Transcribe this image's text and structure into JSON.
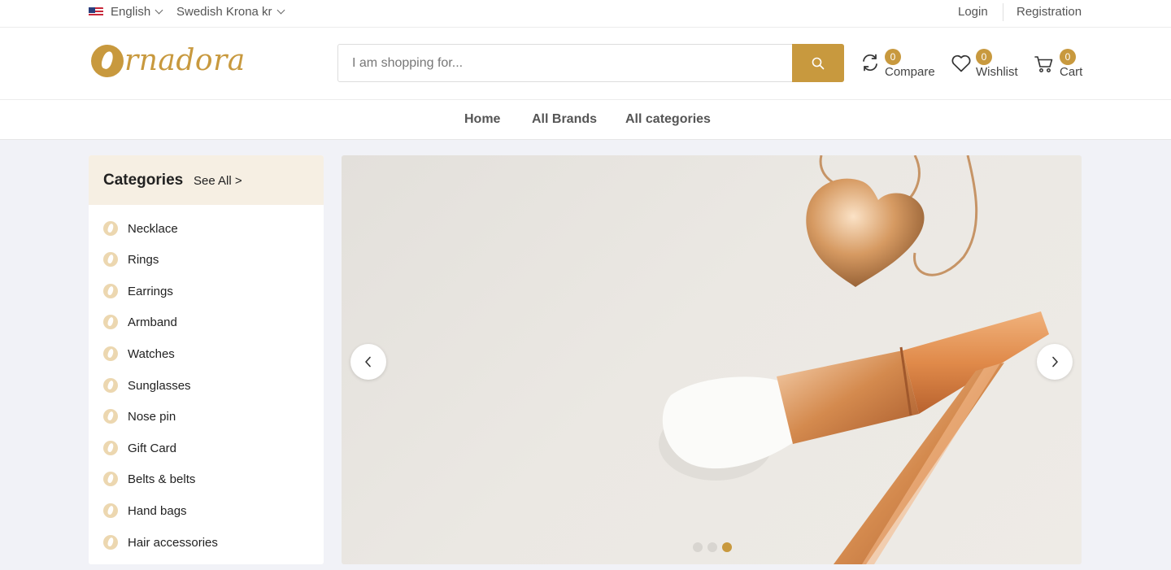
{
  "topbar": {
    "language": "English",
    "currency": "Swedish Krona kr",
    "login": "Login",
    "registration": "Registration"
  },
  "header": {
    "logo_text": "rnadora",
    "search": {
      "placeholder": "I am shopping for..."
    },
    "compare": {
      "label": "Compare",
      "count": "0"
    },
    "wishlist": {
      "label": "Wishlist",
      "count": "0"
    },
    "cart": {
      "label": "Cart",
      "count": "0"
    }
  },
  "nav": {
    "items": [
      "Home",
      "All Brands",
      "All categories"
    ]
  },
  "categories": {
    "title": "Categories",
    "see_all": "See All >",
    "items": [
      "Necklace",
      "Rings",
      "Earrings",
      "Armband",
      "Watches",
      "Sunglasses",
      "Nose pin",
      "Gift Card",
      "Belts & belts",
      "Hand bags",
      "Hair accessories"
    ]
  },
  "slider": {
    "slide_count": 3,
    "active_slide": 3
  },
  "colors": {
    "accent": "#c8993e",
    "page_bg": "#f1f2f7",
    "category_header_bg": "#f6efe3"
  },
  "icons": [
    "flag-us-icon",
    "chevron-down-icon",
    "search-icon",
    "compare-icon",
    "heart-icon",
    "cart-icon",
    "category-icon",
    "chevron-left-icon",
    "chevron-right-icon"
  ]
}
